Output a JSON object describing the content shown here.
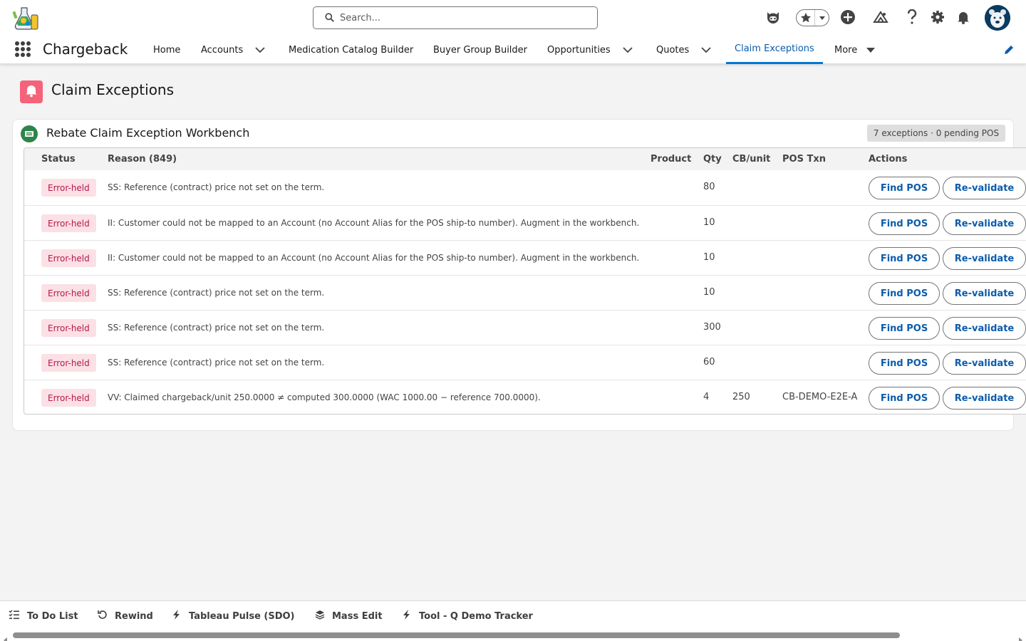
{
  "header": {
    "search_placeholder": "Search...",
    "icons": [
      "app-logo",
      "agentforce-icon",
      "favorites-star-icon",
      "favorites-dropdown-icon",
      "global-create-icon",
      "trailhead-icon",
      "help-icon",
      "setup-gear-icon",
      "notifications-bell-icon",
      "user-avatar"
    ]
  },
  "nav": {
    "app_name": "Chargeback",
    "items": [
      {
        "label": "Home",
        "has_menu": false
      },
      {
        "label": "Accounts",
        "has_menu": true
      },
      {
        "label": "Medication Catalog Builder",
        "has_menu": false
      },
      {
        "label": "Buyer Group Builder",
        "has_menu": false
      },
      {
        "label": "Opportunities",
        "has_menu": true
      },
      {
        "label": "Quotes",
        "has_menu": true
      },
      {
        "label": "Claim Exceptions",
        "has_menu": false,
        "active": true
      },
      {
        "label": "More",
        "has_menu": true
      }
    ]
  },
  "page": {
    "title": "Claim Exceptions",
    "icon": "bell-icon",
    "accent": "#f4637a"
  },
  "card": {
    "title": "Rebate Claim Exception Workbench",
    "count_label": "7 exceptions · 0 pending POS",
    "columns": [
      "Status",
      "Reason (849)",
      "Product",
      "Qty",
      "CB/unit",
      "POS Txn",
      "Actions"
    ],
    "find_label": "Find POS",
    "revalidate_label": "Re-validate",
    "rows": [
      {
        "status": "Error-held",
        "reason": "SS: Reference (contract) price not set on the term.",
        "product": "",
        "qty": "80",
        "cb_unit": "",
        "pos_txn": ""
      },
      {
        "status": "Error-held",
        "reason": "II: Customer could not be mapped to an Account (no Account Alias for the POS ship-to number). Augment in the workbench.",
        "product": "",
        "qty": "10",
        "cb_unit": "",
        "pos_txn": ""
      },
      {
        "status": "Error-held",
        "reason": "II: Customer could not be mapped to an Account (no Account Alias for the POS ship-to number). Augment in the workbench.",
        "product": "",
        "qty": "10",
        "cb_unit": "",
        "pos_txn": ""
      },
      {
        "status": "Error-held",
        "reason": "SS: Reference (contract) price not set on the term.",
        "product": "",
        "qty": "10",
        "cb_unit": "",
        "pos_txn": ""
      },
      {
        "status": "Error-held",
        "reason": "SS: Reference (contract) price not set on the term.",
        "product": "",
        "qty": "300",
        "cb_unit": "",
        "pos_txn": ""
      },
      {
        "status": "Error-held",
        "reason": "SS: Reference (contract) price not set on the term.",
        "product": "",
        "qty": "60",
        "cb_unit": "",
        "pos_txn": ""
      },
      {
        "status": "Error-held",
        "reason": "VV: Claimed chargeback/unit 250.0000 ≠ computed 300.0000 (WAC 1000.00 − reference 700.0000).",
        "product": "",
        "qty": "4",
        "cb_unit": "250",
        "pos_txn": "CB-DEMO-E2E-A"
      }
    ]
  },
  "utility_bar": {
    "items": [
      {
        "label": "To Do List",
        "icon": "checklist-icon"
      },
      {
        "label": "Rewind",
        "icon": "rewind-icon"
      },
      {
        "label": "Tableau Pulse (SDO)",
        "icon": "lightning-icon"
      },
      {
        "label": "Mass Edit",
        "icon": "stack-icon"
      },
      {
        "label": "Tool - Q Demo Tracker",
        "icon": "lightning-icon"
      }
    ]
  },
  "colors": {
    "brand": "#0176d3",
    "link": "#0b5cab",
    "badge_bg": "#fbe0e6",
    "badge_text": "#b5184b",
    "card_icon": "#2e844a"
  }
}
